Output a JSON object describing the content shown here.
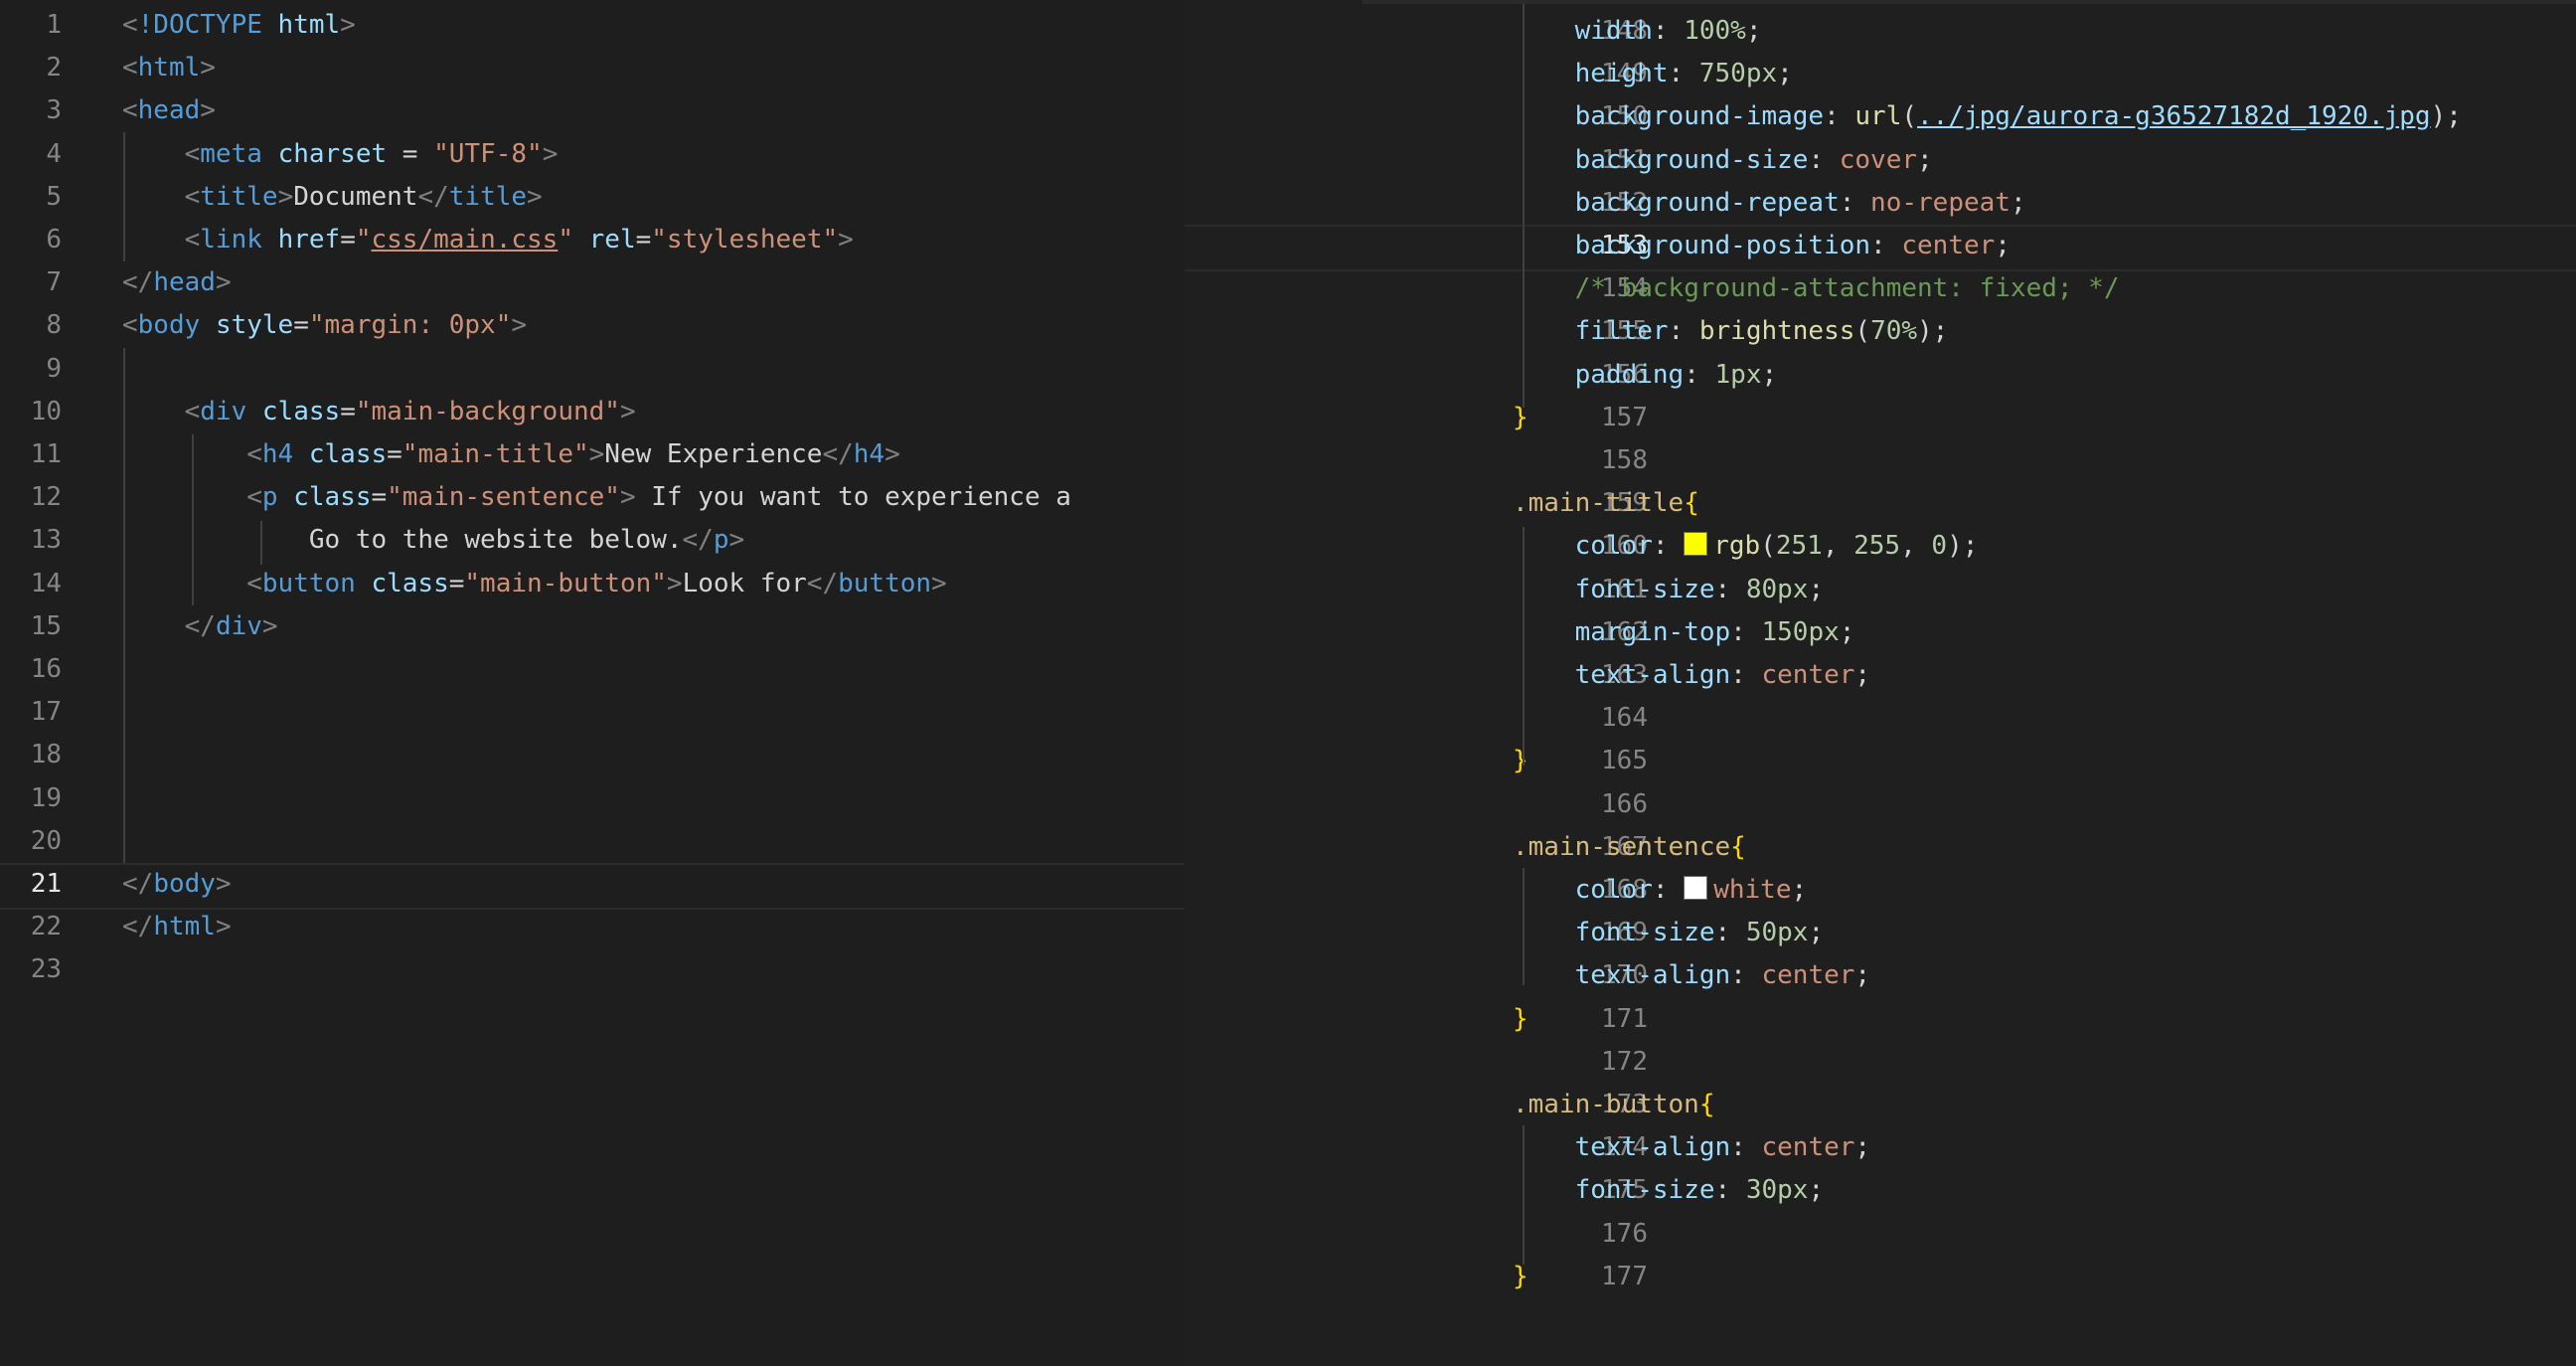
{
  "colors": {
    "background": "#1e1e1e",
    "tag": "#569cd6",
    "attribute": "#9cdcfe",
    "string": "#ce9178",
    "selector": "#d7ba7d",
    "brace": "#ffd700",
    "number": "#b5cea8",
    "comment": "#6a9955",
    "yellow_swatch": "rgb(251, 255, 0)",
    "white_swatch": "#ffffff"
  },
  "left_editor": {
    "file": "html",
    "active_line": "21",
    "lines": [
      {
        "n": "1",
        "tokens": [
          [
            "tb",
            "<"
          ],
          [
            "tg",
            "!DOCTYPE"
          ],
          [
            "tx",
            " "
          ],
          [
            "at",
            "html"
          ],
          [
            "tb",
            ">"
          ]
        ]
      },
      {
        "n": "2",
        "tokens": [
          [
            "tb",
            "<"
          ],
          [
            "tg",
            "html"
          ],
          [
            "tb",
            ">"
          ]
        ]
      },
      {
        "n": "3",
        "tokens": [
          [
            "tb",
            "<"
          ],
          [
            "tg",
            "head"
          ],
          [
            "tb",
            ">"
          ]
        ]
      },
      {
        "n": "4",
        "tokens": [
          [
            "tx",
            "    "
          ],
          [
            "tb",
            "<"
          ],
          [
            "tg",
            "meta"
          ],
          [
            "tx",
            " "
          ],
          [
            "at",
            "charset"
          ],
          [
            "tx",
            " = "
          ],
          [
            "st",
            "\"UTF-8\""
          ],
          [
            "tb",
            ">"
          ]
        ]
      },
      {
        "n": "5",
        "tokens": [
          [
            "tx",
            "    "
          ],
          [
            "tb",
            "<"
          ],
          [
            "tg",
            "title"
          ],
          [
            "tb",
            ">"
          ],
          [
            "tx",
            "Document"
          ],
          [
            "tb",
            "</"
          ],
          [
            "tg",
            "title"
          ],
          [
            "tb",
            ">"
          ]
        ]
      },
      {
        "n": "6",
        "tokens": [
          [
            "tx",
            "    "
          ],
          [
            "tb",
            "<"
          ],
          [
            "tg",
            "link"
          ],
          [
            "tx",
            " "
          ],
          [
            "at",
            "href"
          ],
          [
            "tx",
            "="
          ],
          [
            "st",
            "\""
          ],
          [
            "st_link",
            "css/main.css"
          ],
          [
            "st",
            "\""
          ],
          [
            "tx",
            " "
          ],
          [
            "at",
            "rel"
          ],
          [
            "tx",
            "="
          ],
          [
            "st",
            "\"stylesheet\""
          ],
          [
            "tb",
            ">"
          ]
        ]
      },
      {
        "n": "7",
        "tokens": [
          [
            "tb",
            "</"
          ],
          [
            "tg",
            "head"
          ],
          [
            "tb",
            ">"
          ]
        ]
      },
      {
        "n": "8",
        "tokens": [
          [
            "tb",
            "<"
          ],
          [
            "tg",
            "body"
          ],
          [
            "tx",
            " "
          ],
          [
            "at",
            "style"
          ],
          [
            "tx",
            "="
          ],
          [
            "st",
            "\"margin: 0px\""
          ],
          [
            "tb",
            ">"
          ]
        ]
      },
      {
        "n": "9",
        "tokens": []
      },
      {
        "n": "10",
        "tokens": [
          [
            "tx",
            "    "
          ],
          [
            "tb",
            "<"
          ],
          [
            "tg",
            "div"
          ],
          [
            "tx",
            " "
          ],
          [
            "at",
            "class"
          ],
          [
            "tx",
            "="
          ],
          [
            "st",
            "\"main-background\""
          ],
          [
            "tb",
            ">"
          ]
        ]
      },
      {
        "n": "11",
        "tokens": [
          [
            "tx",
            "        "
          ],
          [
            "tb",
            "<"
          ],
          [
            "tg",
            "h4"
          ],
          [
            "tx",
            " "
          ],
          [
            "at",
            "class"
          ],
          [
            "tx",
            "="
          ],
          [
            "st",
            "\"main-title\""
          ],
          [
            "tb",
            ">"
          ],
          [
            "tx",
            "New Experience"
          ],
          [
            "tb",
            "</"
          ],
          [
            "tg",
            "h4"
          ],
          [
            "tb",
            ">"
          ]
        ]
      },
      {
        "n": "12",
        "tokens": [
          [
            "tx",
            "        "
          ],
          [
            "tb",
            "<"
          ],
          [
            "tg",
            "p"
          ],
          [
            "tx",
            " "
          ],
          [
            "at",
            "class"
          ],
          [
            "tx",
            "="
          ],
          [
            "st",
            "\"main-sentence\""
          ],
          [
            "tb",
            ">"
          ],
          [
            "tx",
            " If you want to experience a"
          ]
        ]
      },
      {
        "n": "13",
        "tokens": [
          [
            "tx",
            "            Go to the website below."
          ],
          [
            "tb",
            "</"
          ],
          [
            "tg",
            "p"
          ],
          [
            "tb",
            ">"
          ]
        ]
      },
      {
        "n": "14",
        "tokens": [
          [
            "tx",
            "        "
          ],
          [
            "tb",
            "<"
          ],
          [
            "tg",
            "button"
          ],
          [
            "tx",
            " "
          ],
          [
            "at",
            "class"
          ],
          [
            "tx",
            "="
          ],
          [
            "st",
            "\"main-button\""
          ],
          [
            "tb",
            ">"
          ],
          [
            "tx",
            "Look for"
          ],
          [
            "tb",
            "</"
          ],
          [
            "tg",
            "button"
          ],
          [
            "tb",
            ">"
          ]
        ]
      },
      {
        "n": "15",
        "tokens": [
          [
            "tx",
            "    "
          ],
          [
            "tb",
            "</"
          ],
          [
            "tg",
            "div"
          ],
          [
            "tb",
            ">"
          ]
        ]
      },
      {
        "n": "16",
        "tokens": []
      },
      {
        "n": "17",
        "tokens": []
      },
      {
        "n": "18",
        "tokens": []
      },
      {
        "n": "19",
        "tokens": []
      },
      {
        "n": "20",
        "tokens": []
      },
      {
        "n": "21",
        "tokens": [
          [
            "tb",
            "</"
          ],
          [
            "tg",
            "body"
          ],
          [
            "tb",
            ">"
          ]
        ]
      },
      {
        "n": "22",
        "tokens": [
          [
            "tb",
            "</"
          ],
          [
            "tg",
            "html"
          ],
          [
            "tb",
            ">"
          ]
        ]
      },
      {
        "n": "23",
        "tokens": []
      }
    ]
  },
  "right_editor": {
    "file": "css",
    "active_line": "153",
    "lines": [
      {
        "n": "148",
        "tokens": [
          [
            "tx",
            "    "
          ],
          [
            "at",
            "width"
          ],
          [
            "tx",
            ": "
          ],
          [
            "nu",
            "100%"
          ],
          [
            "tx",
            ";"
          ]
        ]
      },
      {
        "n": "149",
        "tokens": [
          [
            "tx",
            "    "
          ],
          [
            "at",
            "height"
          ],
          [
            "tx",
            ": "
          ],
          [
            "nu",
            "750px"
          ],
          [
            "tx",
            ";"
          ]
        ]
      },
      {
        "n": "150",
        "tokens": [
          [
            "tx",
            "    "
          ],
          [
            "at",
            "background-image"
          ],
          [
            "tx",
            ": "
          ],
          [
            "fn",
            "url"
          ],
          [
            "tx",
            "("
          ],
          [
            "ln",
            "../jpg/aurora-g36527182d_1920.jpg"
          ],
          [
            "tx",
            ");"
          ]
        ]
      },
      {
        "n": "151",
        "tokens": [
          [
            "tx",
            "    "
          ],
          [
            "at",
            "background-size"
          ],
          [
            "tx",
            ": "
          ],
          [
            "st",
            "cover"
          ],
          [
            "tx",
            ";"
          ]
        ]
      },
      {
        "n": "152",
        "tokens": [
          [
            "tx",
            "    "
          ],
          [
            "at",
            "background-repeat"
          ],
          [
            "tx",
            ": "
          ],
          [
            "st",
            "no-repeat"
          ],
          [
            "tx",
            ";"
          ]
        ]
      },
      {
        "n": "153",
        "tokens": [
          [
            "tx",
            "    "
          ],
          [
            "at",
            "background-position"
          ],
          [
            "tx",
            ": "
          ],
          [
            "st",
            "center"
          ],
          [
            "tx",
            ";"
          ]
        ]
      },
      {
        "n": "154",
        "tokens": [
          [
            "tx",
            "    "
          ],
          [
            "cm",
            "/* background-attachment: fixed; */"
          ]
        ]
      },
      {
        "n": "155",
        "tokens": [
          [
            "tx",
            "    "
          ],
          [
            "at",
            "filter"
          ],
          [
            "tx",
            ": "
          ],
          [
            "fn",
            "brightness"
          ],
          [
            "tx",
            "("
          ],
          [
            "nu",
            "70%"
          ],
          [
            "tx",
            ");"
          ]
        ]
      },
      {
        "n": "156",
        "tokens": [
          [
            "tx",
            "    "
          ],
          [
            "at",
            "padding"
          ],
          [
            "tx",
            ": "
          ],
          [
            "nu",
            "1px"
          ],
          [
            "tx",
            ";"
          ]
        ]
      },
      {
        "n": "157",
        "tokens": [
          [
            "br",
            "}"
          ]
        ]
      },
      {
        "n": "158",
        "tokens": []
      },
      {
        "n": "159",
        "tokens": [
          [
            "sel",
            ".main-title"
          ],
          [
            "br",
            "{"
          ]
        ]
      },
      {
        "n": "160",
        "tokens": [
          [
            "tx",
            "    "
          ],
          [
            "at",
            "color"
          ],
          [
            "tx",
            ": "
          ],
          [
            "swatch_yellow",
            ""
          ],
          [
            "fn",
            "rgb"
          ],
          [
            "tx",
            "("
          ],
          [
            "nu",
            "251"
          ],
          [
            "tx",
            ", "
          ],
          [
            "nu",
            "255"
          ],
          [
            "tx",
            ", "
          ],
          [
            "nu",
            "0"
          ],
          [
            "tx",
            ");"
          ]
        ]
      },
      {
        "n": "161",
        "tokens": [
          [
            "tx",
            "    "
          ],
          [
            "at",
            "font-size"
          ],
          [
            "tx",
            ": "
          ],
          [
            "nu",
            "80px"
          ],
          [
            "tx",
            ";"
          ]
        ]
      },
      {
        "n": "162",
        "tokens": [
          [
            "tx",
            "    "
          ],
          [
            "at",
            "margin-top"
          ],
          [
            "tx",
            ": "
          ],
          [
            "nu",
            "150px"
          ],
          [
            "tx",
            ";"
          ]
        ]
      },
      {
        "n": "163",
        "tokens": [
          [
            "tx",
            "    "
          ],
          [
            "at",
            "text-align"
          ],
          [
            "tx",
            ": "
          ],
          [
            "st",
            "center"
          ],
          [
            "tx",
            ";"
          ]
        ]
      },
      {
        "n": "164",
        "tokens": []
      },
      {
        "n": "165",
        "tokens": [
          [
            "br",
            "}"
          ]
        ]
      },
      {
        "n": "166",
        "tokens": []
      },
      {
        "n": "167",
        "tokens": [
          [
            "sel",
            ".main-sentence"
          ],
          [
            "br",
            "{"
          ]
        ]
      },
      {
        "n": "168",
        "tokens": [
          [
            "tx",
            "    "
          ],
          [
            "at",
            "color"
          ],
          [
            "tx",
            ": "
          ],
          [
            "swatch_white",
            ""
          ],
          [
            "st",
            "white"
          ],
          [
            "tx",
            ";"
          ]
        ]
      },
      {
        "n": "169",
        "tokens": [
          [
            "tx",
            "    "
          ],
          [
            "at",
            "font-size"
          ],
          [
            "tx",
            ": "
          ],
          [
            "nu",
            "50px"
          ],
          [
            "tx",
            ";"
          ]
        ]
      },
      {
        "n": "170",
        "tokens": [
          [
            "tx",
            "    "
          ],
          [
            "at",
            "text-align"
          ],
          [
            "tx",
            ": "
          ],
          [
            "st",
            "center"
          ],
          [
            "tx",
            ";"
          ]
        ]
      },
      {
        "n": "171",
        "tokens": [
          [
            "br",
            "}"
          ]
        ]
      },
      {
        "n": "172",
        "tokens": []
      },
      {
        "n": "173",
        "tokens": [
          [
            "sel",
            ".main-button"
          ],
          [
            "br",
            "{"
          ]
        ]
      },
      {
        "n": "174",
        "tokens": [
          [
            "tx",
            "    "
          ],
          [
            "at",
            "text-align"
          ],
          [
            "tx",
            ": "
          ],
          [
            "st",
            "center"
          ],
          [
            "tx",
            ";"
          ]
        ]
      },
      {
        "n": "175",
        "tokens": [
          [
            "tx",
            "    "
          ],
          [
            "at",
            "font-size"
          ],
          [
            "tx",
            ": "
          ],
          [
            "nu",
            "30px"
          ],
          [
            "tx",
            ";"
          ]
        ]
      },
      {
        "n": "176",
        "tokens": []
      },
      {
        "n": "177",
        "tokens": [
          [
            "br",
            "}"
          ]
        ]
      }
    ]
  }
}
